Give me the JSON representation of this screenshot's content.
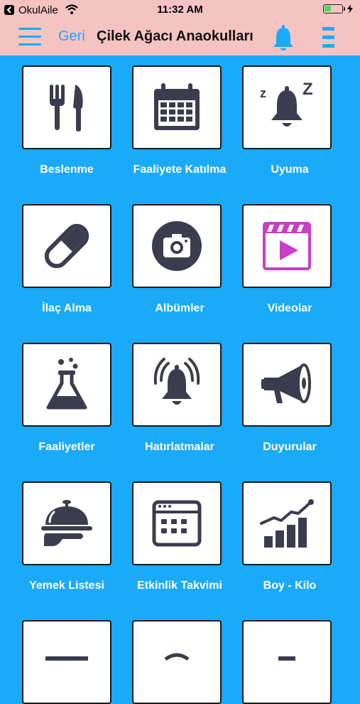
{
  "status_bar": {
    "carrier": "OkulAile",
    "time": "11:32 AM"
  },
  "nav": {
    "back_label": "Geri",
    "title": "Çilek Ağacı Anaokulları"
  },
  "colors": {
    "accent": "#1aaaf7",
    "topbar": "#f5c4c2",
    "icon_dark": "#3b3d4e",
    "video_accent": "#c83ec8"
  },
  "tiles": [
    {
      "label": "Beslenme",
      "icon": "fork-knife-icon"
    },
    {
      "label": "Faaliyete Katılma",
      "icon": "calendar-icon"
    },
    {
      "label": "Uyuma",
      "icon": "sleeping-bell-icon"
    },
    {
      "label": "İlaç Alma",
      "icon": "pill-icon"
    },
    {
      "label": "Albümler",
      "icon": "camera-icon"
    },
    {
      "label": "Videolar",
      "icon": "video-play-icon"
    },
    {
      "label": "Faaliyetler",
      "icon": "flask-icon"
    },
    {
      "label": "Hatırlatmalar",
      "icon": "ringing-bell-icon"
    },
    {
      "label": "Duyurular",
      "icon": "megaphone-icon"
    },
    {
      "label": "Yemek Listesi",
      "icon": "food-cloche-icon"
    },
    {
      "label": "Etkinlik Takvimi",
      "icon": "event-calendar-icon"
    },
    {
      "label": "Boy - Kilo",
      "icon": "growth-chart-icon"
    }
  ]
}
